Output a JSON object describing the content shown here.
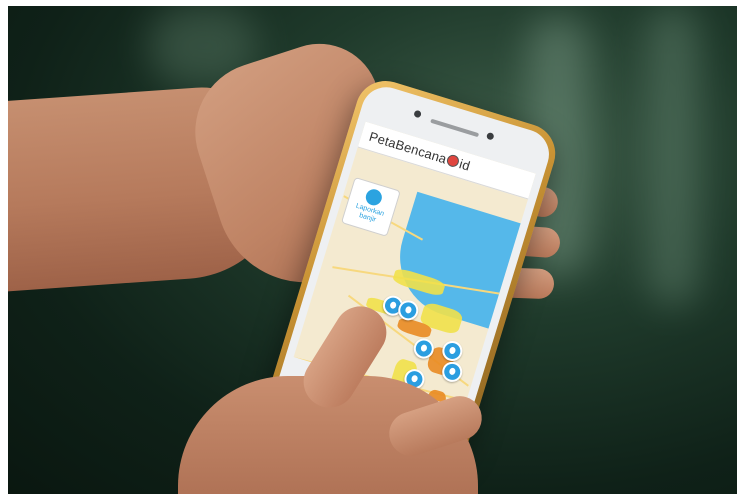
{
  "image": {
    "scene": "hands holding smartphone over dark green water background",
    "app": {
      "title_text": "PetaBencana",
      "title_suffix": "id",
      "report_button_label": "Laporkan banjir",
      "report_icon": "flood-drop-icon",
      "pin_icon": "flood-report-pin-icon"
    },
    "colors": {
      "background": "#1f3a2b",
      "sea": "#55b8ea",
      "flood_yellow": "#f1e14a",
      "flood_orange": "#e98b22",
      "pin": "#2b9ee0",
      "phone_gold": "#c99334"
    }
  }
}
